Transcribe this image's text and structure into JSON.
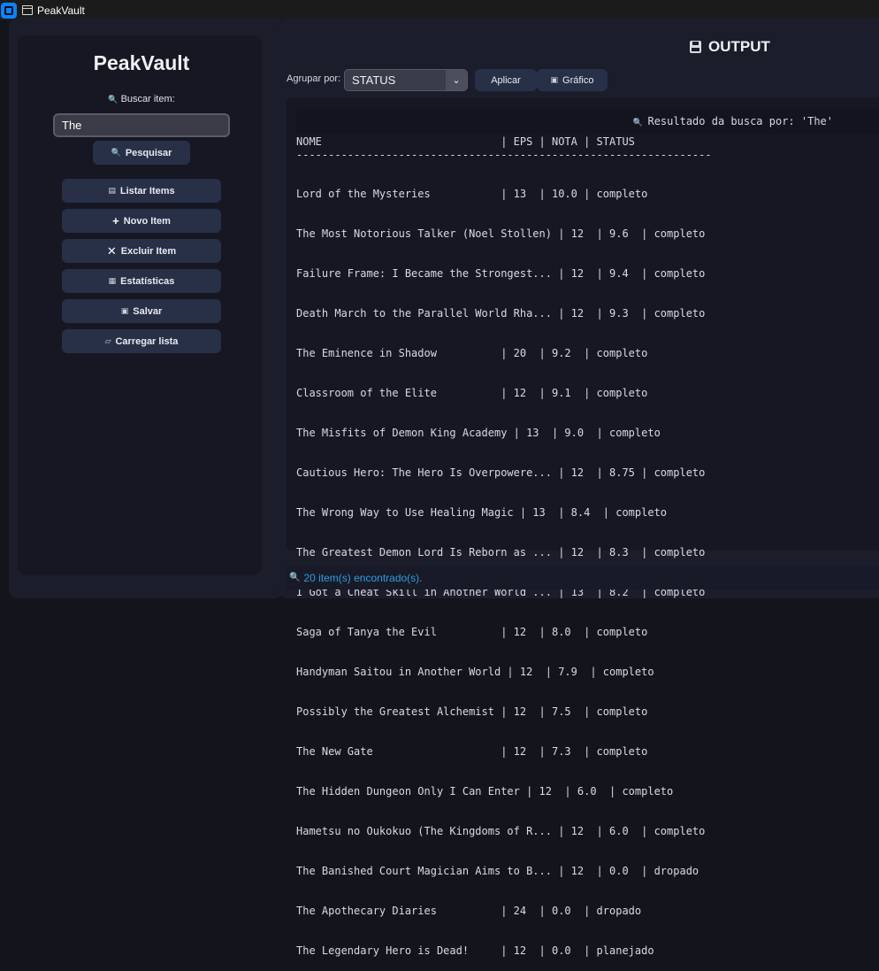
{
  "window": {
    "title": "PeakVault"
  },
  "sidebar": {
    "brand": "PeakVault",
    "search_label": "Buscar item:",
    "search_value": "The",
    "search_button": "Pesquisar",
    "buttons": [
      {
        "label": "Listar Items",
        "icon": "list-icon"
      },
      {
        "label": "Novo Item",
        "icon": "plus-icon"
      },
      {
        "label": "Excluir Item",
        "icon": "close-icon"
      },
      {
        "label": "Estatísticas",
        "icon": "stats-icon"
      },
      {
        "label": "Salvar",
        "icon": "save-icon"
      },
      {
        "label": "Carregar lista",
        "icon": "folder-icon"
      }
    ]
  },
  "main": {
    "title": "OUTPUT",
    "group_label": "Agrupar por:",
    "group_value": "STATUS",
    "apply_button": "Aplicar",
    "chart_button": "Gráfico",
    "result_header": "Resultado da busca por: 'The'",
    "table_head": "NOME                            | EPS | NOTA | STATUS",
    "separator": "-----------------------------------------------------------------",
    "rows": [
      "Lord of the Mysteries           | 13  | 10.0 | completo",
      "The Most Notorious Talker (Noel Stollen) | 12  | 9.6  | completo",
      "Failure Frame: I Became the Strongest... | 12  | 9.4  | completo",
      "Death March to the Parallel World Rha... | 12  | 9.3  | completo",
      "The Eminence in Shadow          | 20  | 9.2  | completo",
      "Classroom of the Elite          | 12  | 9.1  | completo",
      "The Misfits of Demon King Academy | 13  | 9.0  | completo",
      "Cautious Hero: The Hero Is Overpowere... | 12  | 8.75 | completo",
      "The Wrong Way to Use Healing Magic | 13  | 8.4  | completo",
      "The Greatest Demon Lord Is Reborn as ... | 12  | 8.3  | completo",
      "I Got a Cheat Skill in Another World ... | 13  | 8.2  | completo",
      "Saga of Tanya the Evil          | 12  | 8.0  | completo",
      "Handyman Saitou in Another World | 12  | 7.9  | completo",
      "Possibly the Greatest Alchemist | 12  | 7.5  | completo",
      "The New Gate                    | 12  | 7.3  | completo",
      "The Hidden Dungeon Only I Can Enter | 12  | 6.0  | completo",
      "Hametsu no Oukokuo (The Kingdoms of R... | 12  | 6.0  | completo",
      "The Banished Court Magician Aims to B... | 12  | 0.0  | dropado",
      "The Apothecary Diaries          | 24  | 0.0  | dropado",
      "The Legendary Hero is Dead!     | 12  | 0.0  | planejado"
    ],
    "status_text": "20 item(s) encontrado(s)."
  },
  "colors": {
    "accent_blue": "#2b9fe0",
    "button_bg": "#283047",
    "panel_bg": "#1b1d2b"
  }
}
